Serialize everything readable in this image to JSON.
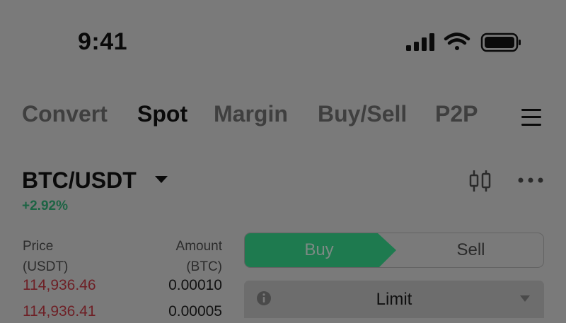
{
  "status_bar": {
    "time": "9:41",
    "icons": [
      "cellular-signal-icon",
      "wifi-icon",
      "battery-icon"
    ]
  },
  "nav": {
    "tabs": [
      {
        "label": "Convert",
        "active": false
      },
      {
        "label": "Spot",
        "active": true
      },
      {
        "label": "Margin",
        "active": false
      },
      {
        "label": "Buy/Sell",
        "active": false
      },
      {
        "label": "P2P",
        "active": false
      }
    ],
    "menu_icon": "hamburger-menu-icon"
  },
  "market": {
    "pair": "BTC/USDT",
    "change": "+2.92%",
    "chart_icon": "candlestick-icon",
    "more_icon": "more-icon"
  },
  "order_book": {
    "price_header": [
      "Price",
      "(USDT)"
    ],
    "amount_header": [
      "Amount",
      "(BTC)"
    ],
    "rows": [
      {
        "price": "114,936.46",
        "amount": "0.00010"
      },
      {
        "price": "114,936.41",
        "amount": "0.00005"
      }
    ]
  },
  "trade": {
    "buy_label": "Buy",
    "sell_label": "Sell",
    "order_type": "Limit"
  },
  "colors": {
    "overlay_background": "#7a7a7a",
    "buy_green": "#1e7a4f",
    "change_green": "#1d6444",
    "ask_red": "#6e1f25"
  }
}
